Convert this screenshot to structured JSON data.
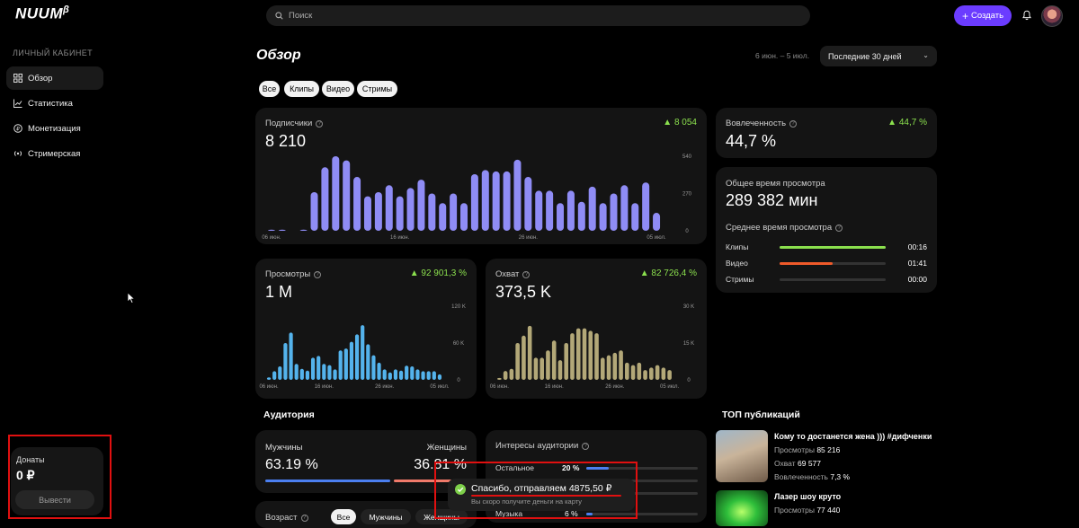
{
  "app": {
    "logo": "NUUM",
    "logo_badge": "β"
  },
  "sidebar": {
    "title": "ЛИЧНЫЙ КАБИНЕТ",
    "items": [
      {
        "label": "Обзор",
        "icon": "grid-icon"
      },
      {
        "label": "Статистика",
        "icon": "chart-icon"
      },
      {
        "label": "Монетизация",
        "icon": "coin-icon"
      },
      {
        "label": "Стримерская",
        "icon": "broadcast-icon"
      }
    ],
    "donations": {
      "label": "Донаты",
      "value": "0 ₽",
      "button": "Вывести"
    }
  },
  "header": {
    "search_placeholder": "Поиск",
    "create_label": "Создать"
  },
  "page": {
    "title": "Обзор",
    "range": "6 июн. – 5 июл.",
    "period": "Последние 30 дней",
    "filters": [
      "Все",
      "Клипы",
      "Видео",
      "Стримы"
    ]
  },
  "cards": {
    "subscribers": {
      "label": "Подписчики",
      "value": "8 210",
      "delta": "8 054",
      "color": "#8f8cf5",
      "y_ticks": [
        "540",
        "270",
        "0"
      ],
      "x_ticks": [
        "06 июн.",
        "16 июн.",
        "26 июн.",
        "05 июл."
      ]
    },
    "views": {
      "label": "Просмотры",
      "value": "1 M",
      "delta": "92 901,3 %",
      "color": "#54b3ec",
      "y_ticks": [
        "120 K",
        "60 K",
        "0"
      ],
      "x_ticks": [
        "06 июн.",
        "16 июн.",
        "26 июн.",
        "05 июл."
      ]
    },
    "reach": {
      "label": "Охват",
      "value": "373,5 K",
      "delta": "82 726,4 %",
      "color": "#b3a878",
      "y_ticks": [
        "30 K",
        "15 K",
        "0"
      ],
      "x_ticks": [
        "06 июн.",
        "16 июн.",
        "26 июн.",
        "05 июл."
      ]
    },
    "engagement": {
      "label": "Вовлеченность",
      "value": "44,7 %",
      "delta": "44,7 %"
    },
    "watch_time": {
      "label": "Общее время просмотра",
      "value": "289 382 мин",
      "avg_label": "Среднее время просмотра",
      "rows": [
        {
          "label": "Клипы",
          "value": "00:16",
          "fill": 1.0,
          "color": "#8be04e"
        },
        {
          "label": "Видео",
          "value": "01:41",
          "fill": 0.5,
          "color": "#ef5a2a"
        },
        {
          "label": "Стримы",
          "value": "00:00",
          "fill": 0.0,
          "color": "#555555"
        }
      ]
    }
  },
  "chart_data": [
    {
      "type": "bar",
      "title": "Подписчики",
      "x_ticks": [
        "06 июн.",
        "16 июн.",
        "26 июн.",
        "05 июл."
      ],
      "ylim": [
        0,
        540
      ],
      "values": [
        6,
        6,
        0,
        4,
        280,
        460,
        540,
        510,
        390,
        250,
        280,
        330,
        250,
        310,
        370,
        270,
        200,
        270,
        200,
        410,
        440,
        430,
        430,
        515,
        390,
        290,
        290,
        200,
        290,
        210,
        320,
        200,
        270,
        330,
        200,
        350,
        130
      ]
    },
    {
      "type": "bar",
      "title": "Просмотры",
      "x_ticks": [
        "06 июн.",
        "16 июн.",
        "26 июн.",
        "05 июл."
      ],
      "ylim": [
        0,
        120000
      ],
      "values": [
        4000,
        14000,
        22000,
        60000,
        77000,
        26000,
        18000,
        15000,
        36000,
        39000,
        26000,
        24000,
        17000,
        48000,
        51000,
        62000,
        74000,
        89000,
        58000,
        40000,
        28000,
        17000,
        12000,
        17000,
        15000,
        23000,
        22000,
        17000,
        14000,
        14000,
        14000,
        9000
      ]
    },
    {
      "type": "bar",
      "title": "Охват",
      "x_ticks": [
        "06 июн.",
        "16 июн.",
        "26 июн.",
        "05 июл."
      ],
      "ylim": [
        0,
        30000
      ],
      "values": [
        800,
        3600,
        4500,
        15000,
        18000,
        22000,
        9000,
        9000,
        12000,
        16000,
        8000,
        15000,
        19000,
        21000,
        21000,
        20000,
        19000,
        9000,
        10000,
        11000,
        12000,
        7000,
        6000,
        7000,
        4000,
        5000,
        6000,
        5000,
        4000
      ]
    }
  ],
  "audience": {
    "title": "Аудитория",
    "gender": {
      "male_label": "Мужчины",
      "male_value": "63.19 %",
      "female_label": "Женщины",
      "female_value": "36.81 %",
      "male_color": "#4b7ff0",
      "female_color": "#f07a6a"
    },
    "interests": {
      "label": "Интересы аудитории",
      "rows": [
        {
          "label": "Остальное",
          "value": "20 %",
          "fill": 0.2
        },
        {
          "label": "Музыка",
          "value": "6 %",
          "fill": 0.06
        }
      ]
    },
    "age": {
      "label": "Возраст",
      "tabs": [
        "Все",
        "Мужчины",
        "Женщины"
      ]
    }
  },
  "top": {
    "title": "ТОП публикаций",
    "items": [
      {
        "title": "Кому то достанется жена ))) #дифченки",
        "views_label": "Просмотры",
        "views": "85 216",
        "reach_label": "Охват",
        "reach": "69 577",
        "eng_label": "Вовлеченность",
        "eng": "7,3 %"
      },
      {
        "title": "Лазер шоу круто",
        "views_label": "Просмотры",
        "views": "77 440"
      }
    ]
  },
  "toast": {
    "title": "Спасибо, отправляем 4875,50 ₽",
    "subtitle": "Вы скоро получите деньги на карту"
  }
}
